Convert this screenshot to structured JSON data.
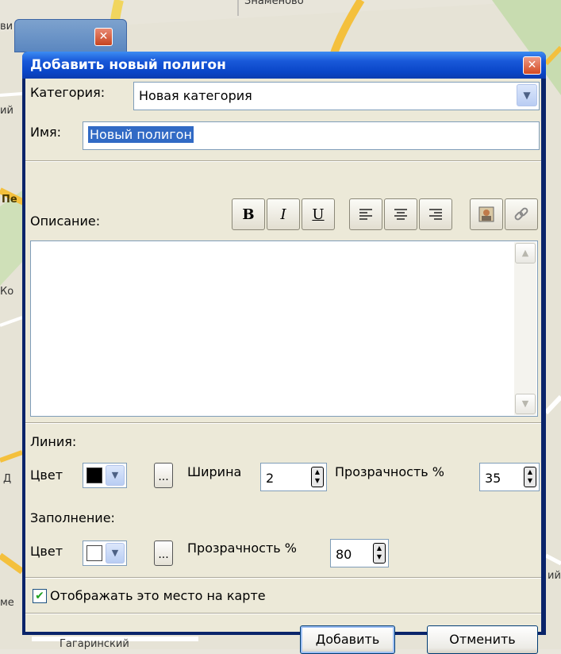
{
  "map": {
    "labels": [
      "ви",
      "ий",
      "Пе",
      "Ко",
      "Д",
      "ме",
      "ий",
      "Гагаринский",
      "Знаменово"
    ]
  },
  "dialog": {
    "title": "Добавить новый полигон",
    "category_label": "Категория:",
    "category_value": "Новая категория",
    "name_label": "Имя:",
    "name_value": "Новый полигон",
    "description_label": "Описание:",
    "toolbar": {
      "bold": "B",
      "italic": "I",
      "underline": "U"
    },
    "line": {
      "section_label": "Линия:",
      "color_label": "Цвет",
      "color": "#000000",
      "width_label": "Ширина",
      "width_value": "2",
      "opacity_label": "Прозрачность %",
      "opacity_value": "35",
      "more_label": "..."
    },
    "fill": {
      "section_label": "Заполнение:",
      "color_label": "Цвет",
      "color": "#ffffff",
      "opacity_label": "Прозрачность %",
      "opacity_value": "80",
      "more_label": "..."
    },
    "show_on_map_label": "Отображать это место на карте",
    "show_on_map_checked": true,
    "add_button": "Добавить",
    "cancel_button": "Отменить"
  },
  "colors": {
    "title_bar": "#0a46c8",
    "dialog_bg": "#ece9d8",
    "selection": "#316ac5"
  }
}
